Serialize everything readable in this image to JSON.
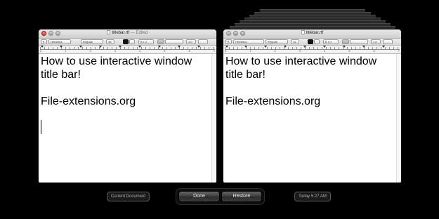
{
  "left_window": {
    "title": "titlebar.rtf",
    "edited": "— Edited",
    "toolbar": {
      "font": "Helvetica",
      "style": "Regular",
      "size": "36",
      "spacing": "1.0"
    },
    "ruler_numbers": [
      "0",
      "1",
      "2",
      "3",
      "4",
      "5",
      "6",
      "7"
    ],
    "content": {
      "line1": "How to use interactive window",
      "line2": "title bar!",
      "line3": "File-extensions.org"
    }
  },
  "right_window": {
    "title": "titlebar.rtf",
    "toolbar": {
      "font": "Helvetica",
      "style": "Regular",
      "size": "12",
      "spacing": "1.0"
    },
    "ruler_numbers": [
      "0",
      "1",
      "2",
      "3",
      "4",
      "5",
      "6",
      "7"
    ],
    "content": {
      "line1": "How to use interactive window",
      "line2": "title bar!",
      "line3": "File-extensions.org"
    }
  },
  "bottom": {
    "current_document": "Current Document",
    "done": "Done",
    "restore": "Restore",
    "timestamp": "Today 5:27 AM"
  }
}
